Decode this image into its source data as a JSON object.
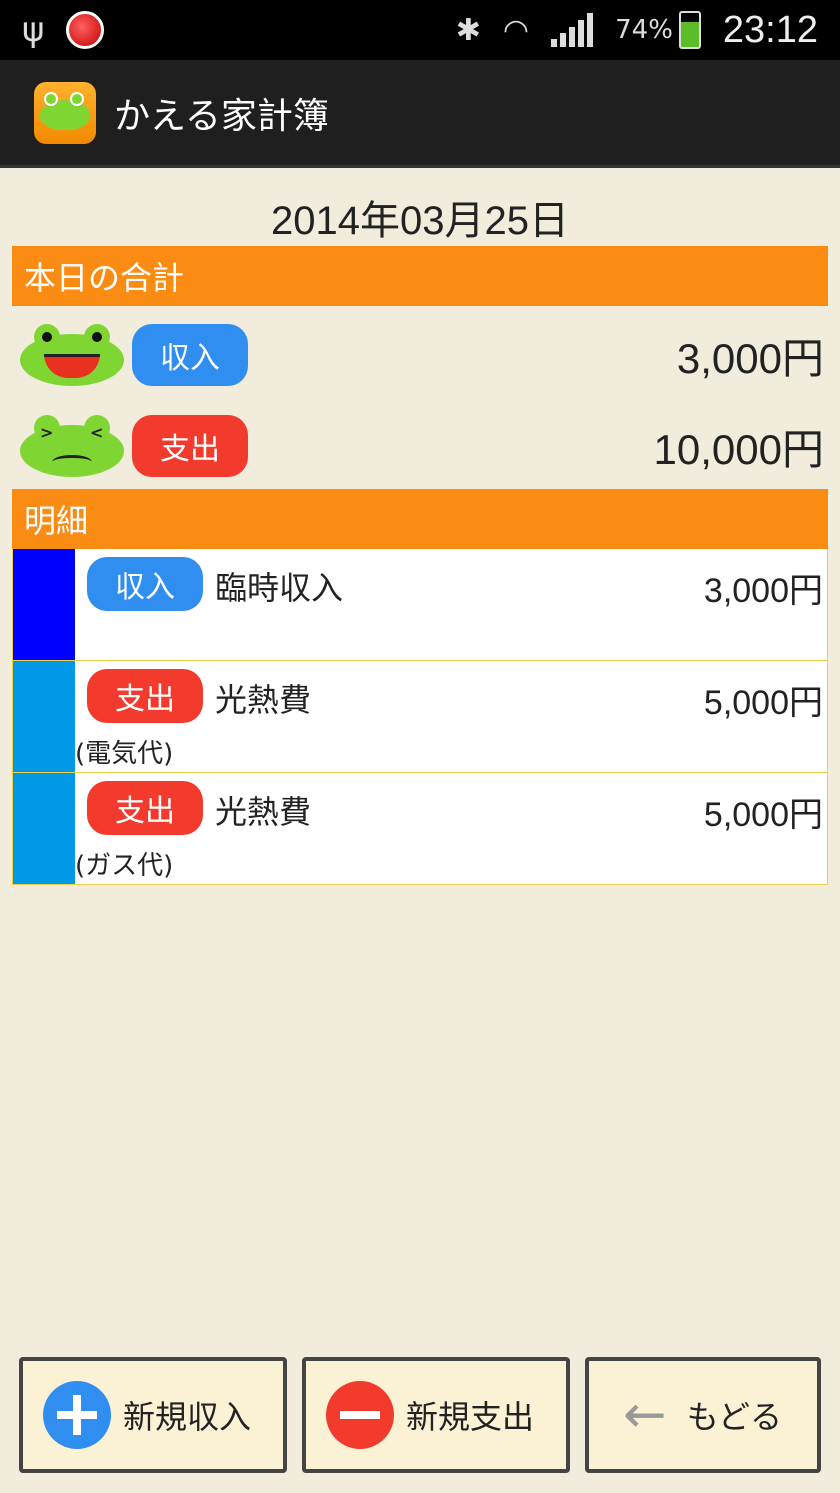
{
  "status_bar": {
    "battery": "74%",
    "time": "23:12"
  },
  "app": {
    "title": "かえる家計簿"
  },
  "date": "2014年03月25日",
  "summary": {
    "header": "本日の合計",
    "income": {
      "label": "収入",
      "amount": "3,000円"
    },
    "expense": {
      "label": "支出",
      "amount": "10,000円"
    }
  },
  "details": {
    "header": "明細",
    "items": [
      {
        "type": "収入",
        "category": "臨時収入",
        "amount": "3,000円",
        "note": "",
        "bar_color": "#0000ff"
      },
      {
        "type": "支出",
        "category": "光熱費",
        "amount": "5,000円",
        "note": "(電気代)",
        "bar_color": "#0099e6"
      },
      {
        "type": "支出",
        "category": "光熱費",
        "amount": "5,000円",
        "note": "(ガス代)",
        "bar_color": "#0099e6"
      }
    ]
  },
  "buttons": {
    "new_income": "新規収入",
    "new_expense": "新規支出",
    "back": "もどる"
  },
  "colors": {
    "section_header": "#fb8c13",
    "income_pill": "#2f8ef0",
    "expense_pill": "#f23b2c"
  }
}
